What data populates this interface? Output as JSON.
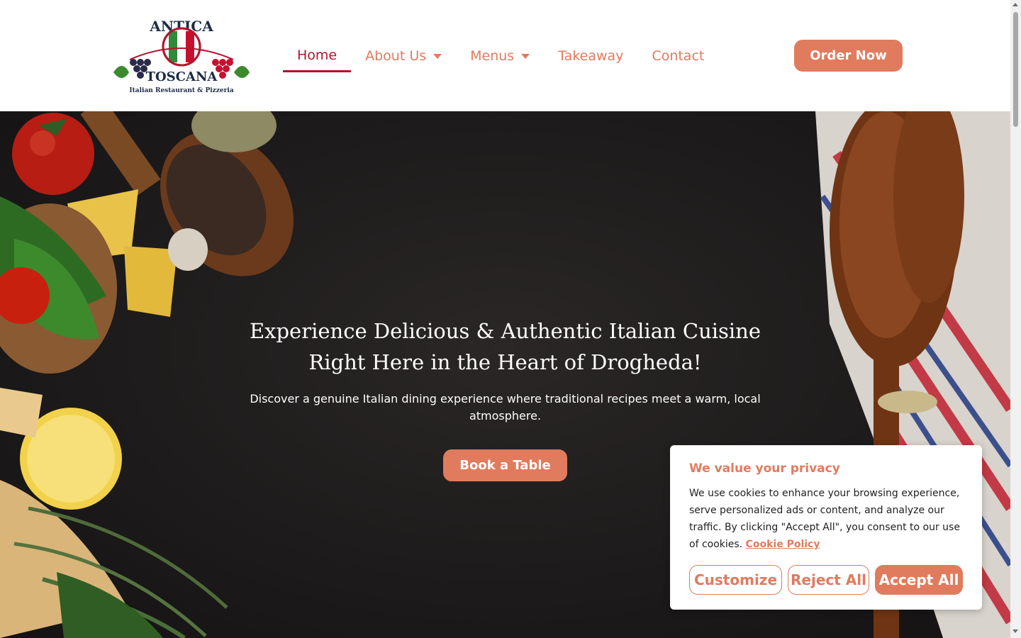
{
  "logo": {
    "top_text": "ANTICA",
    "middle_text": "TOSCANA",
    "bottom_text": "Italian Restaurant & Pizzeria"
  },
  "nav": {
    "items": [
      {
        "label": "Home",
        "active": true,
        "dropdown": false
      },
      {
        "label": "About Us",
        "active": false,
        "dropdown": true
      },
      {
        "label": "Menus",
        "active": false,
        "dropdown": true
      },
      {
        "label": "Takeaway",
        "active": false,
        "dropdown": false
      },
      {
        "label": "Contact",
        "active": false,
        "dropdown": false
      }
    ],
    "order_button": "Order Now"
  },
  "hero": {
    "headline_line1": "Experience Delicious & Authentic Italian Cuisine",
    "headline_line2": "Right Here in the Heart of Drogheda!",
    "subtext": "Discover a genuine Italian dining experience where traditional recipes meet a warm, local atmosphere.",
    "cta": "Book a Table"
  },
  "cookie": {
    "title": "We value your privacy",
    "text": "We use cookies to enhance your browsing experience, serve personalized ads or content, and analyze our traffic. By clicking \"Accept All\", you consent to our use of cookies.",
    "link": "Cookie Policy",
    "customize": "Customize",
    "reject": "Reject All",
    "accept": "Accept All"
  },
  "colors": {
    "accent": "#e07b5e",
    "active_nav": "#b3142e",
    "hero_bg": "#1d1b1b"
  }
}
